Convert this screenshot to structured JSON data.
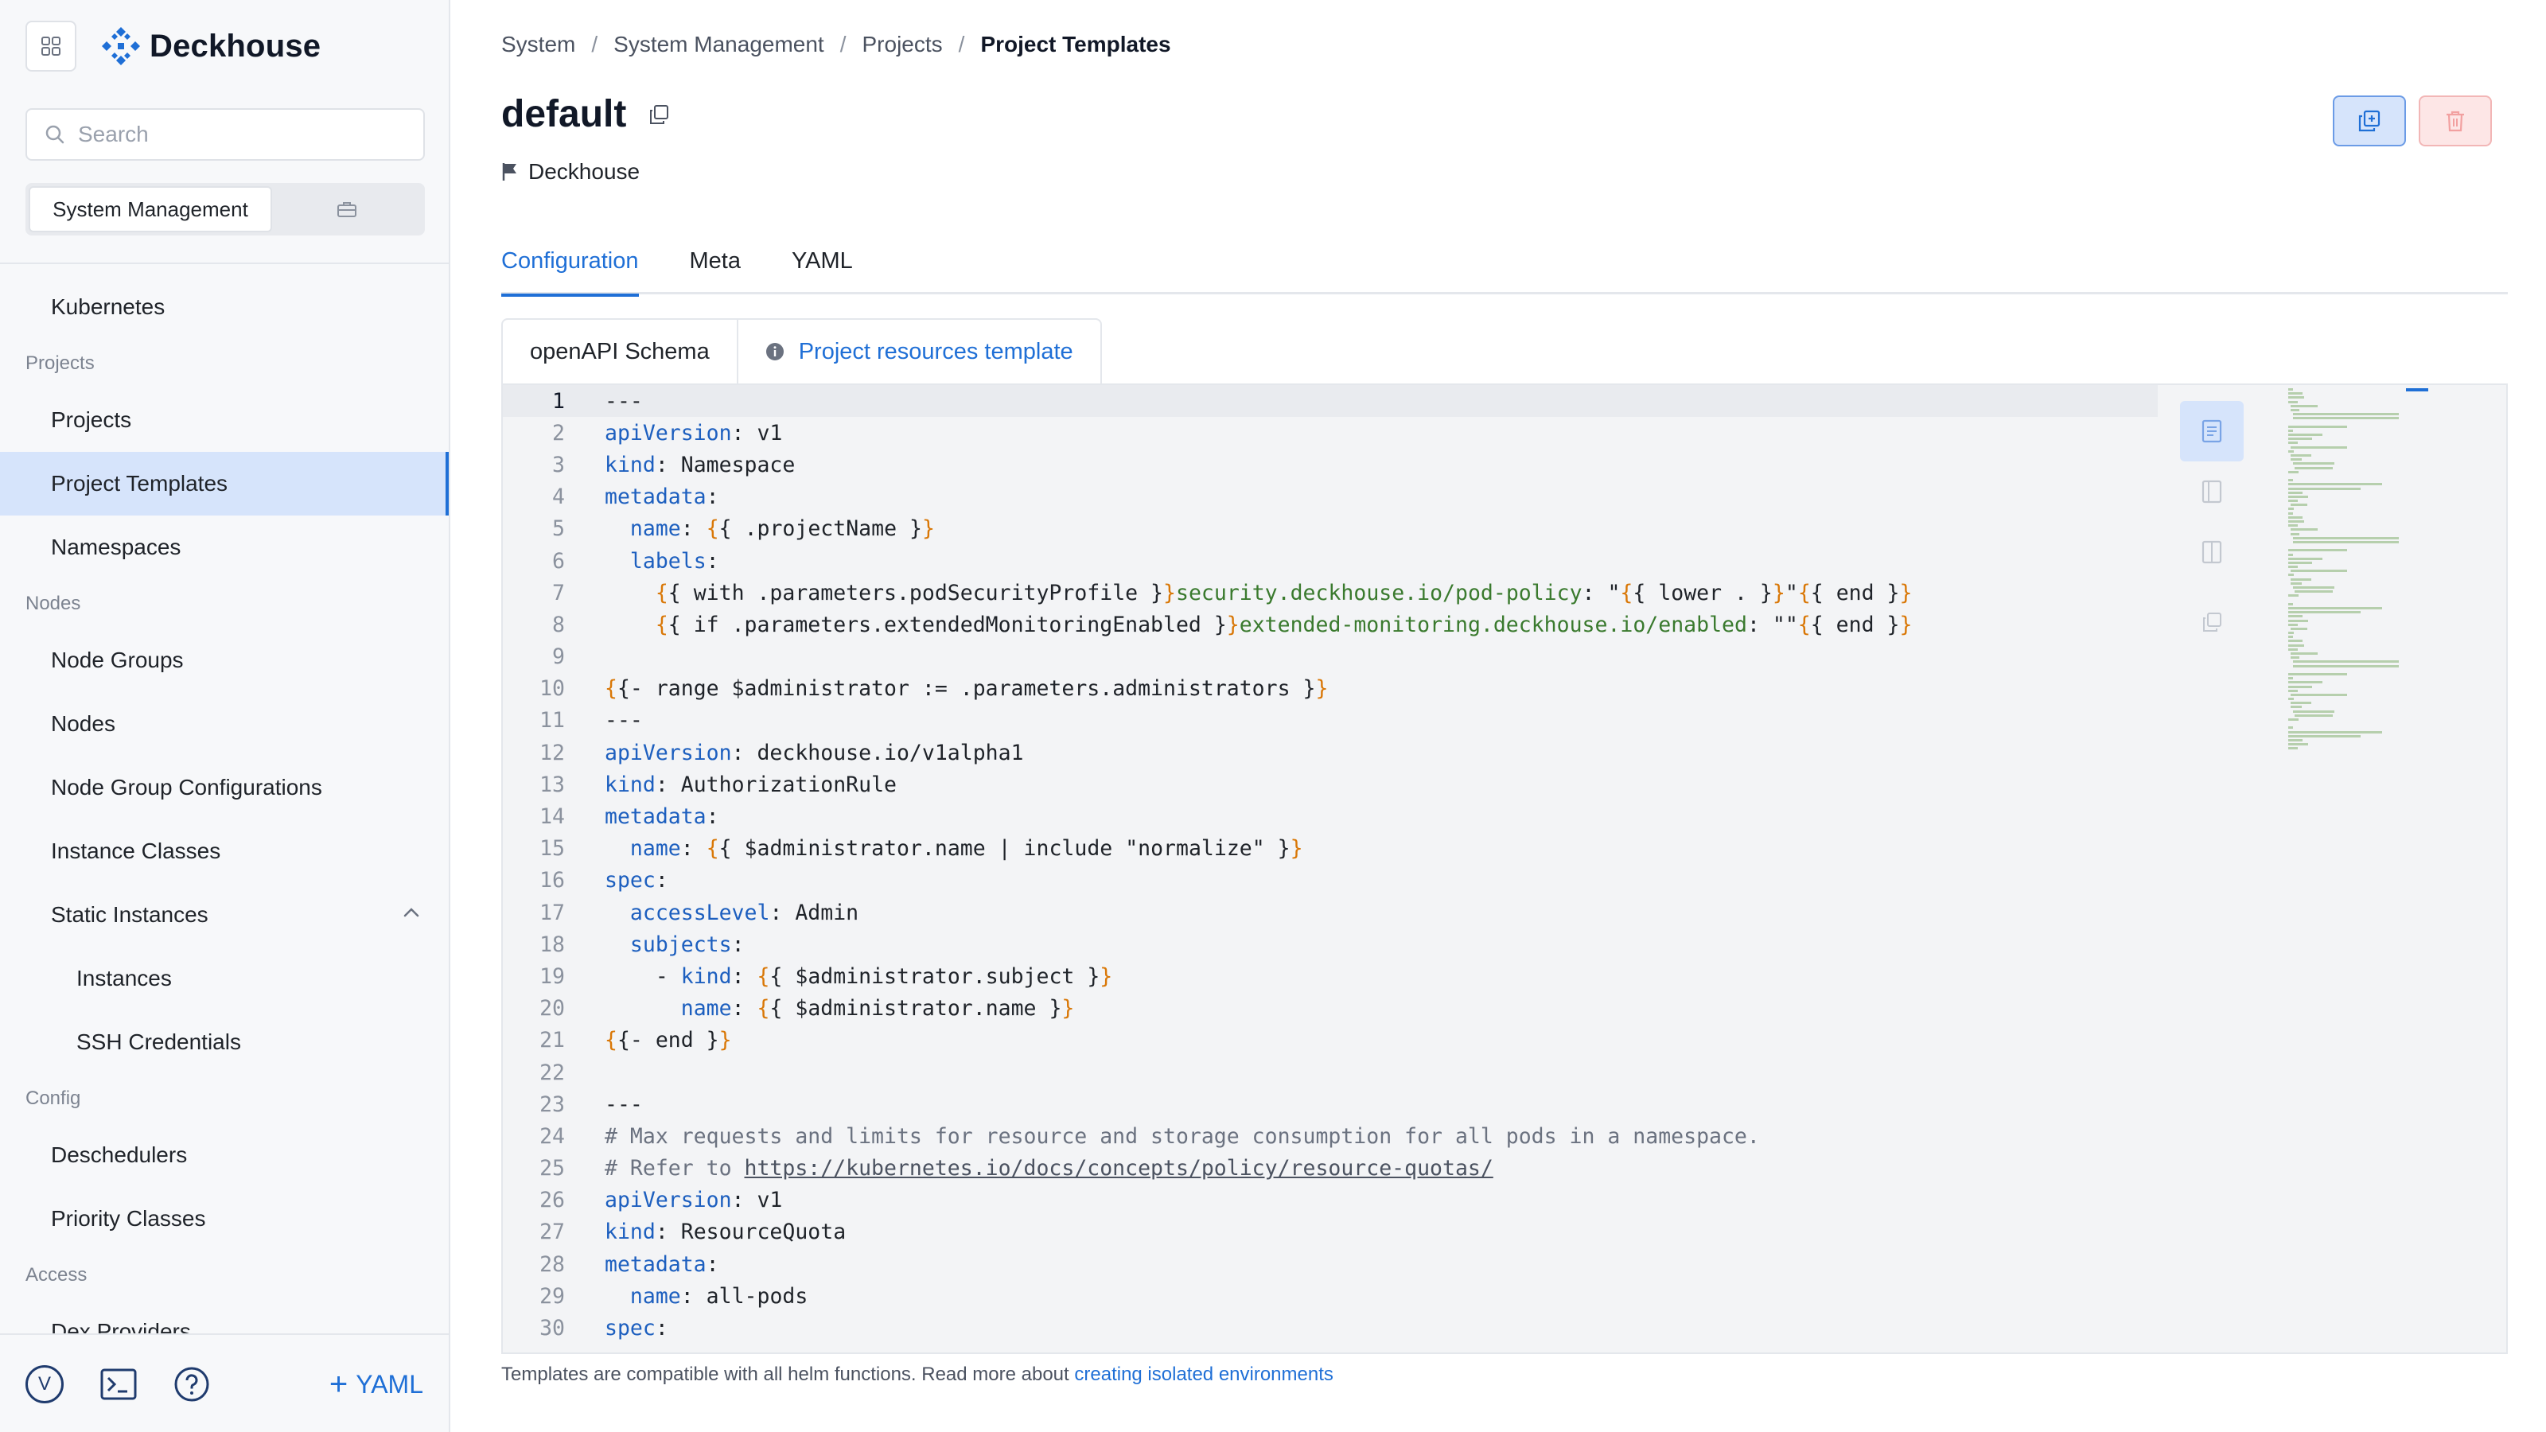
{
  "brand": {
    "name": "Deckhouse"
  },
  "search": {
    "placeholder": "Search"
  },
  "context_switch": {
    "active_label": "System Management"
  },
  "nav": {
    "kubernetes": "Kubernetes",
    "section_projects": "Projects",
    "projects": "Projects",
    "project_templates": "Project Templates",
    "namespaces": "Namespaces",
    "section_nodes": "Nodes",
    "node_groups": "Node Groups",
    "nodes": "Nodes",
    "node_group_configurations": "Node Group Configurations",
    "instance_classes": "Instance Classes",
    "static_instances": "Static Instances",
    "instances": "Instances",
    "ssh_credentials": "SSH Credentials",
    "section_config": "Config",
    "deschedulers": "Deschedulers",
    "priority_classes": "Priority Classes",
    "section_access": "Access",
    "dex_providers": "Dex Providers"
  },
  "bottom": {
    "avatar_letter": "V",
    "yaml_label": "YAML"
  },
  "breadcrumb": [
    "System",
    "System Management",
    "Projects",
    "Project Templates"
  ],
  "page": {
    "title": "default",
    "owner": "Deckhouse"
  },
  "tabs": [
    "Configuration",
    "Meta",
    "YAML"
  ],
  "subtabs": [
    "openAPI Schema",
    "Project resources template"
  ],
  "editor": {
    "current_line": 1,
    "lines": [
      "---",
      "apiVersion: v1",
      "kind: Namespace",
      "metadata:",
      "  name: {{ .projectName }}",
      "  labels:",
      "    {{ with .parameters.podSecurityProfile }}security.deckhouse.io/pod-policy: \"{{ lower . }}\"{{ end }}",
      "    {{ if .parameters.extendedMonitoringEnabled }}extended-monitoring.deckhouse.io/enabled: \"\"{{ end }}",
      "",
      "{{- range $administrator := .parameters.administrators }}",
      "---",
      "apiVersion: deckhouse.io/v1alpha1",
      "kind: AuthorizationRule",
      "metadata:",
      "  name: {{ $administrator.name | include \"normalize\" }}",
      "spec:",
      "  accessLevel: Admin",
      "  subjects:",
      "    - kind: {{ $administrator.subject }}",
      "      name: {{ $administrator.name }}",
      "{{- end }}",
      "",
      "---",
      "# Max requests and limits for resource and storage consumption for all pods in a namespace.",
      "# Refer to https://kubernetes.io/docs/concepts/policy/resource-quotas/",
      "apiVersion: v1",
      "kind: ResourceQuota",
      "metadata:",
      "  name: all-pods",
      "spec:"
    ]
  },
  "footer": {
    "text": "Templates are compatible with all helm functions. Read more about ",
    "link": "creating isolated environments"
  },
  "colors": {
    "accent": "#1f6fd6",
    "active_nav_bg": "#d6e4fb",
    "yaml_key": "#1d5fbf",
    "template_brace": "#d97706",
    "label_string": "#3a7a2e",
    "delete_bg": "#fde6e6"
  },
  "icons": {
    "apps": "grid-icon",
    "logo": "deckhouse-logo-icon",
    "search": "search-icon",
    "briefcase": "briefcase-icon",
    "copy": "copy-icon",
    "flag": "flag-icon",
    "clone": "clone-icon",
    "delete": "trash-icon",
    "info": "info-icon",
    "terminal": "terminal-icon",
    "help": "help-icon"
  }
}
